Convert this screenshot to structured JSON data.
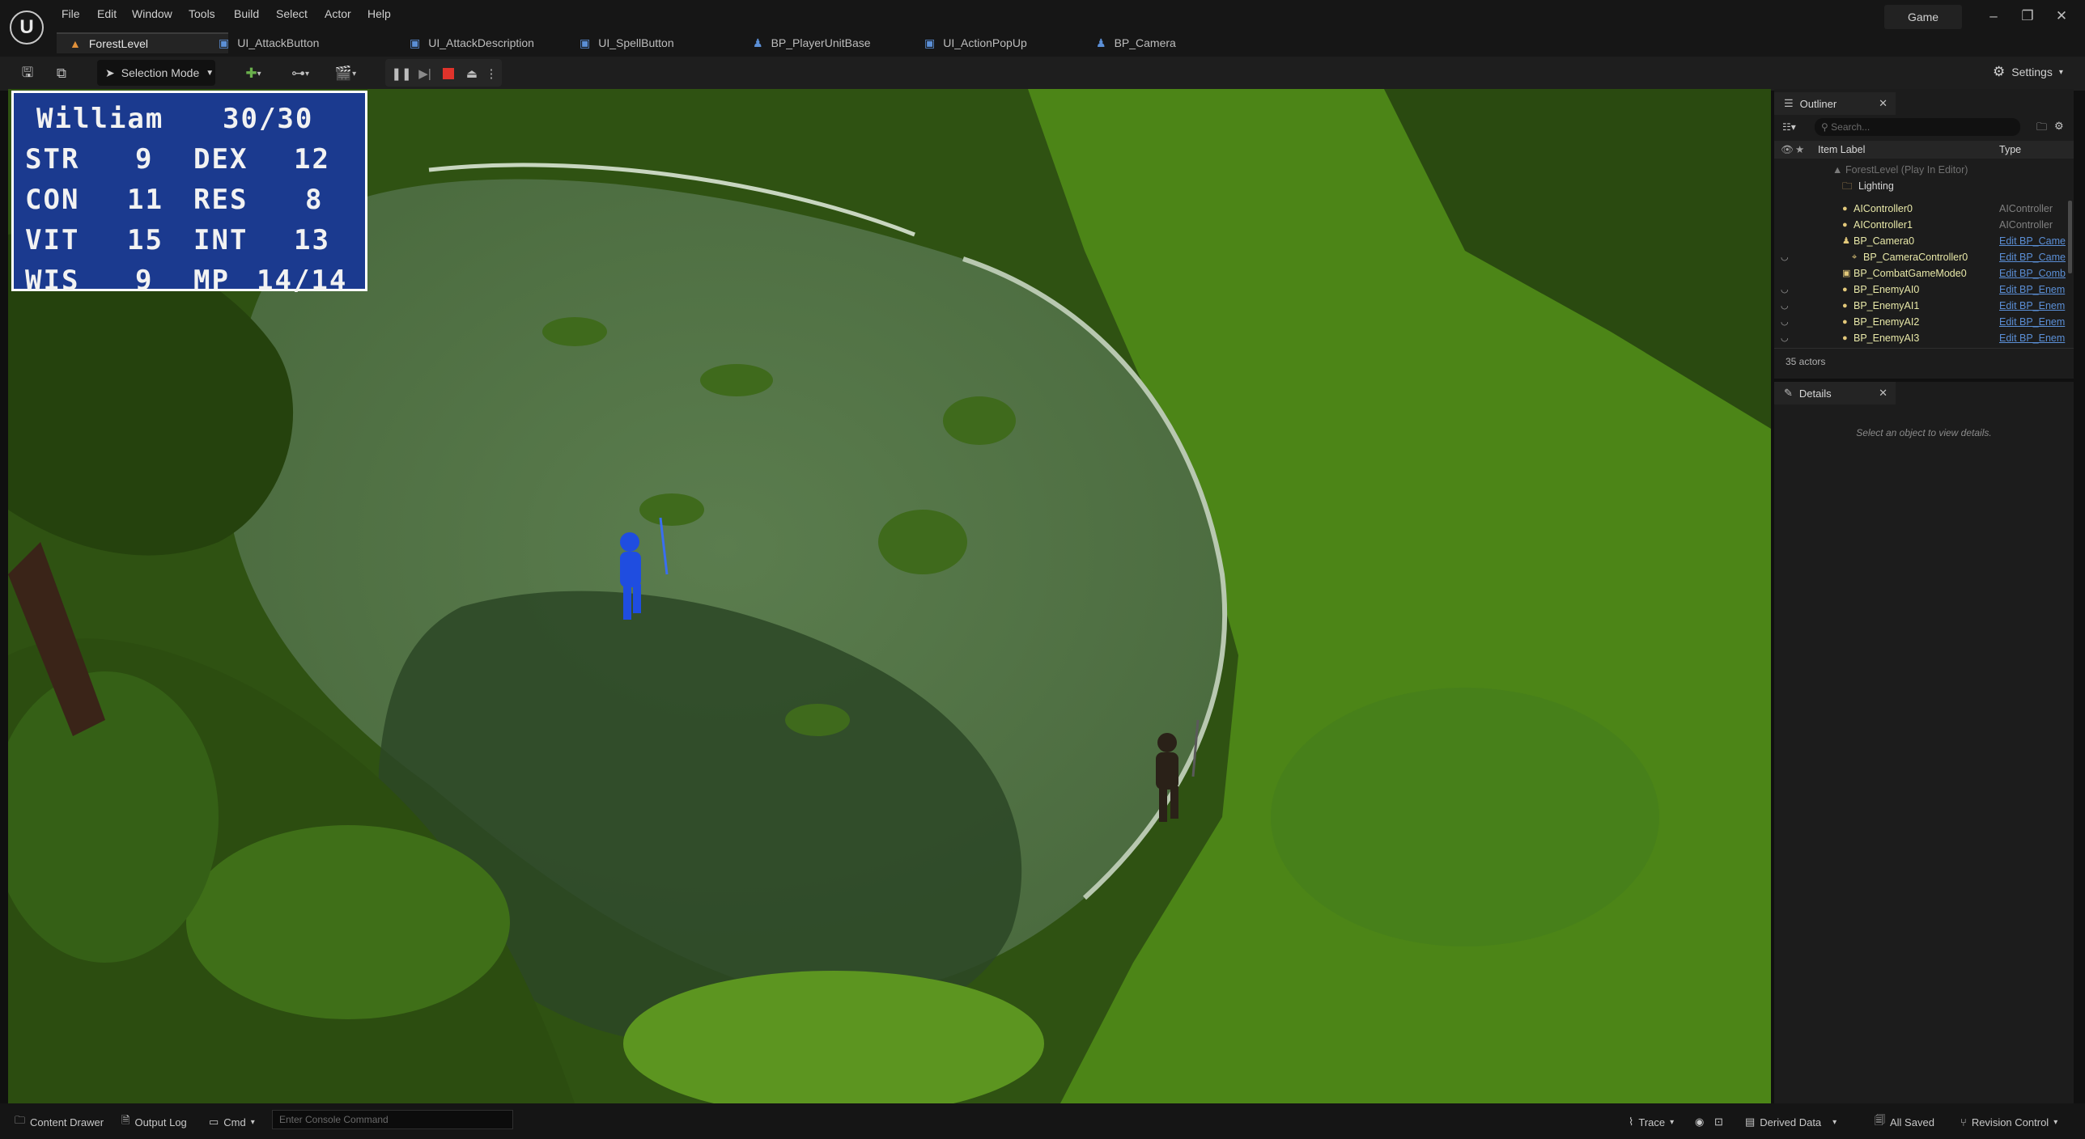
{
  "app": {
    "menu": [
      "File",
      "Edit",
      "Window",
      "Tools",
      "Build",
      "Select",
      "Actor",
      "Help"
    ],
    "mode_label": "Game",
    "tabs": [
      {
        "label": "ForestLevel",
        "active": true,
        "icon": "level-icon"
      },
      {
        "label": "UI_AttackButton",
        "icon": "widget-icon"
      },
      {
        "label": "UI_AttackDescription",
        "icon": "widget-icon"
      },
      {
        "label": "UI_SpellButton",
        "icon": "widget-icon"
      },
      {
        "label": "BP_PlayerUnitBase",
        "icon": "pawn-icon"
      },
      {
        "label": "UI_ActionPopUp",
        "icon": "widget-icon"
      },
      {
        "label": "BP_Camera",
        "icon": "pawn-icon"
      }
    ]
  },
  "toolbar": {
    "selection_mode": "Selection Mode",
    "settings_label": "Settings"
  },
  "hud": {
    "name": "William",
    "hp": "30/30",
    "stats": [
      {
        "l1": "STR",
        "v1": "9",
        "l2": "DEX",
        "v2": "12"
      },
      {
        "l1": "CON",
        "v1": "11",
        "l2": "RES",
        "v2": "8"
      },
      {
        "l1": "VIT",
        "v1": "15",
        "l2": "INT",
        "v2": "13"
      },
      {
        "l1": "WIS",
        "v1": "9",
        "l2": "MP",
        "v2": "14/14"
      }
    ]
  },
  "outliner": {
    "title": "Outliner",
    "search_placeholder": "Search...",
    "col_label": "Item Label",
    "col_type": "Type",
    "root": "ForestLevel (Play In Editor)",
    "folder": "Lighting",
    "rows": [
      {
        "name": "AIController0",
        "type": "AIController",
        "link": false
      },
      {
        "name": "AIController1",
        "type": "AIController",
        "link": false
      },
      {
        "name": "BP_Camera0",
        "type": "Edit BP_Came",
        "link": true
      },
      {
        "name": "BP_CameraController0",
        "type": "Edit BP_Came",
        "link": true
      },
      {
        "name": "BP_CombatGameMode0",
        "type": "Edit BP_Comb",
        "link": true
      },
      {
        "name": "BP_EnemyAI0",
        "type": "Edit BP_Enem",
        "link": true
      },
      {
        "name": "BP_EnemyAI1",
        "type": "Edit BP_Enem",
        "link": true
      },
      {
        "name": "BP_EnemyAI2",
        "type": "Edit BP_Enem",
        "link": true
      },
      {
        "name": "BP_EnemyAI3",
        "type": "Edit BP_Enem",
        "link": true
      }
    ],
    "count": "35 actors"
  },
  "details": {
    "title": "Details",
    "empty_msg": "Select an object to view details."
  },
  "status": {
    "content_drawer": "Content Drawer",
    "output_log": "Output Log",
    "cmd": "Cmd",
    "console_placeholder": "Enter Console Command",
    "trace": "Trace",
    "derived_data": "Derived Data",
    "all_saved": "All Saved",
    "revision_control": "Revision Control"
  },
  "colors": {
    "hud_bg": "#1b3a8f",
    "player_unit": "#1f4de0",
    "foliage": "#3d6b14",
    "link": "#5b8fd6"
  }
}
